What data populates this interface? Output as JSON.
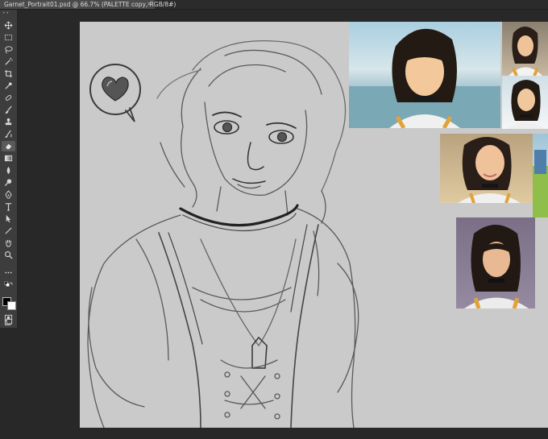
{
  "document": {
    "tab_title": "Garnet_Portrait01.psd @ 66.7% (PALETTE copy, RGB/8#)",
    "close_glyph": "×"
  },
  "toolbar": {
    "grip_glyph": "••",
    "tools": [
      {
        "name": "move-icon"
      },
      {
        "name": "marquee-icon"
      },
      {
        "name": "lasso-icon"
      },
      {
        "name": "magic-wand-icon"
      },
      {
        "name": "crop-icon"
      },
      {
        "name": "eyedropper-icon"
      },
      {
        "name": "healing-brush-icon"
      },
      {
        "name": "brush-icon"
      },
      {
        "name": "clone-stamp-icon"
      },
      {
        "name": "history-brush-icon"
      },
      {
        "name": "eraser-icon"
      },
      {
        "name": "gradient-icon"
      },
      {
        "name": "blur-icon"
      },
      {
        "name": "dodge-icon"
      },
      {
        "name": "pen-icon"
      },
      {
        "name": "type-icon"
      },
      {
        "name": "path-selection-icon"
      },
      {
        "name": "line-icon"
      },
      {
        "name": "hand-icon"
      },
      {
        "name": "zoom-icon"
      },
      {
        "name": "more-tools-icon"
      }
    ],
    "active_tool": "eraser-icon",
    "foreground_color": "#000000",
    "background_color": "#ffffff"
  },
  "canvas": {
    "background": "#cacaca"
  },
  "references": [
    {
      "name": "reference-image-seaside-portrait"
    },
    {
      "name": "reference-image-hair-up"
    },
    {
      "name": "reference-image-smiling"
    },
    {
      "name": "reference-image-side-view"
    },
    {
      "name": "reference-image-partial-edge"
    },
    {
      "name": "reference-image-front-portrait"
    }
  ]
}
